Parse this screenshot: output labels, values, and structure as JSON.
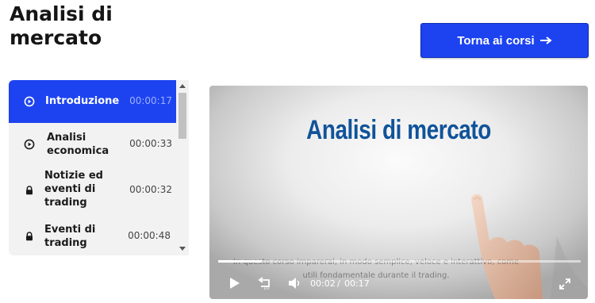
{
  "page": {
    "title": "Analisi di mercato",
    "back_button_label": "Torna ai corsi"
  },
  "lessons": [
    {
      "title": "Introduzione",
      "duration": "00:00:17",
      "state": "playing",
      "icon": "play-circle-icon"
    },
    {
      "title": "Analisi economica",
      "duration": "00:00:33",
      "state": "available",
      "icon": "play-circle-icon"
    },
    {
      "title": "Notizie ed eventi di trading",
      "duration": "00:00:32",
      "state": "locked",
      "icon": "lock-icon"
    },
    {
      "title": "Eventi di trading",
      "duration": "00:00:48",
      "state": "locked",
      "icon": "lock-icon"
    }
  ],
  "video": {
    "heading": "Analisi di mercato",
    "subtitle": "In questo corso imparerai, in modo semplice, veloce e interattivo, come utili fondamentale durante il trading.",
    "current_time": "00:02",
    "separator": "/",
    "duration": "00:17",
    "progress": 0.12,
    "rewind_seconds": "10",
    "icons": [
      "play-icon",
      "rewind-10-icon",
      "volume-icon",
      "fullscreen-icon"
    ]
  },
  "colors": {
    "accent": "#1d43f0",
    "panel": "#f2f2f2",
    "video_heading": "#10539a"
  }
}
